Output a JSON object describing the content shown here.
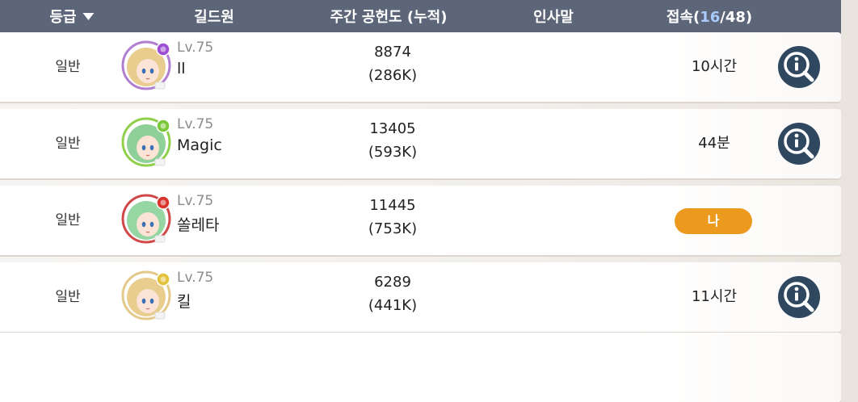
{
  "header": {
    "grade_label": "등급",
    "member_label": "길드원",
    "contribution_label": "주간 공헌도 (누적)",
    "greeting_label": "인사말",
    "online_prefix": "접속(",
    "online_count": "16",
    "online_separator": "/",
    "online_total": "48",
    "online_suffix": ")"
  },
  "members": [
    {
      "grade": "일반",
      "level": "Lv.75",
      "name": "ll",
      "weekly": "8874",
      "total": "(286K)",
      "online": "10시간",
      "is_me": false,
      "hair_color": "#e9cd8e",
      "ring_color": "#b07fd0",
      "emblem_color": "#9c4fd3"
    },
    {
      "grade": "일반",
      "level": "Lv.75",
      "name": "Magic",
      "weekly": "13405",
      "total": "(593K)",
      "online": "44분",
      "is_me": false,
      "hair_color": "#8fcf98",
      "ring_color": "#8fcf4a",
      "emblem_color": "#7cc73a"
    },
    {
      "grade": "일반",
      "level": "Lv.75",
      "name": "쏠레타",
      "weekly": "11445",
      "total": "(753K)",
      "online": "나",
      "is_me": true,
      "hair_color": "#95d6a3",
      "ring_color": "#d04848",
      "emblem_color": "#d9342c"
    },
    {
      "grade": "일반",
      "level": "Lv.75",
      "name": "킬",
      "weekly": "6289",
      "total": "(441K)",
      "online": "11시간",
      "is_me": false,
      "hair_color": "#e9cd8e",
      "ring_color": "#e3c98a",
      "emblem_color": "#e2c23a"
    }
  ],
  "colors": {
    "header_bg": "#5d6678",
    "highlight": "#a9cbff",
    "me_badge": "#ec9a1e",
    "info_button": "#2f4860"
  }
}
